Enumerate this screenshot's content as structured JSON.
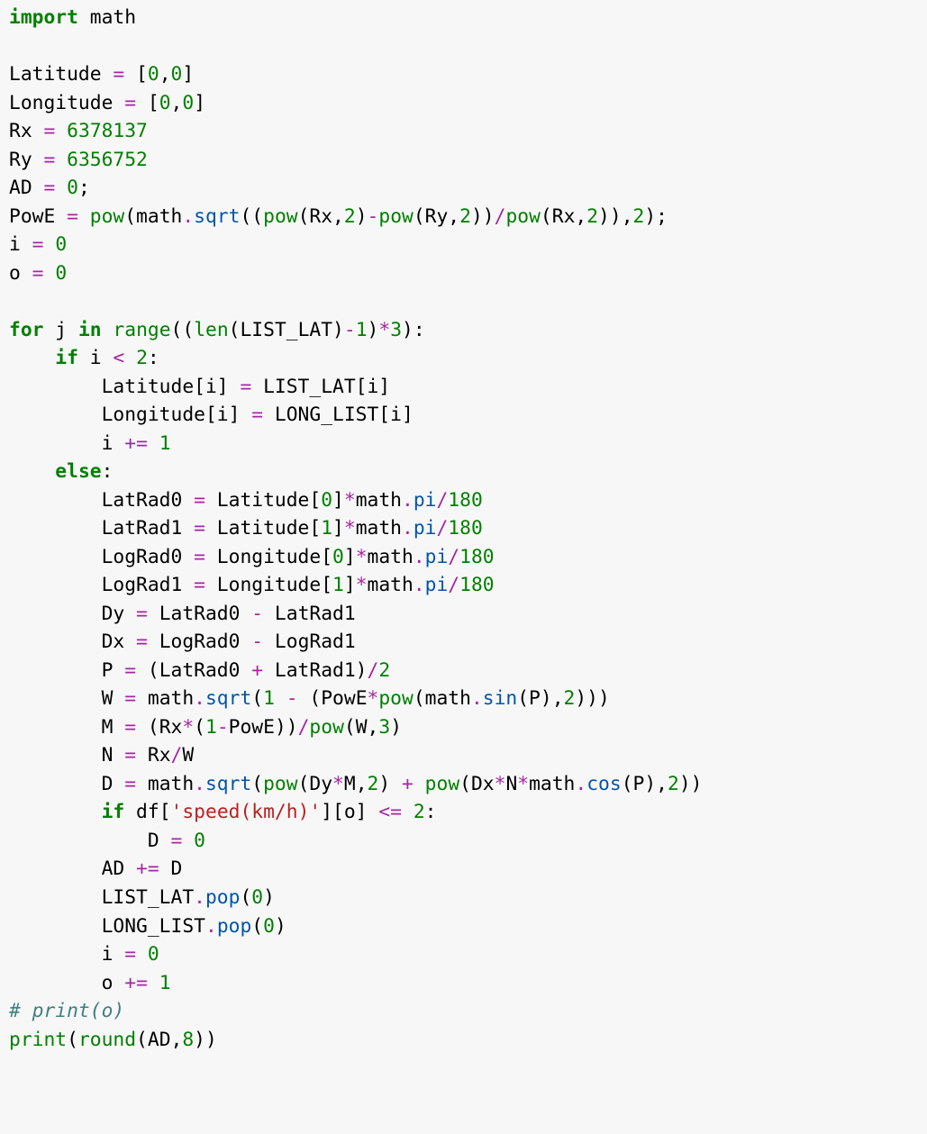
{
  "code": {
    "language": "python",
    "lines": [
      [
        [
          "kw",
          "import"
        ],
        [
          "txt",
          " math"
        ]
      ],
      [],
      [
        [
          "txt",
          "Latitude "
        ],
        [
          "op",
          "="
        ],
        [
          "txt",
          " ["
        ],
        [
          "num",
          "0"
        ],
        [
          "txt",
          ","
        ],
        [
          "num",
          "0"
        ],
        [
          "txt",
          "]"
        ]
      ],
      [
        [
          "txt",
          "Longitude "
        ],
        [
          "op",
          "="
        ],
        [
          "txt",
          " ["
        ],
        [
          "num",
          "0"
        ],
        [
          "txt",
          ","
        ],
        [
          "num",
          "0"
        ],
        [
          "txt",
          "]"
        ]
      ],
      [
        [
          "txt",
          "Rx "
        ],
        [
          "op",
          "="
        ],
        [
          "txt",
          " "
        ],
        [
          "num",
          "6378137"
        ]
      ],
      [
        [
          "txt",
          "Ry "
        ],
        [
          "op",
          "="
        ],
        [
          "txt",
          " "
        ],
        [
          "num",
          "6356752"
        ]
      ],
      [
        [
          "txt",
          "AD "
        ],
        [
          "op",
          "="
        ],
        [
          "txt",
          " "
        ],
        [
          "num",
          "0"
        ],
        [
          "txt",
          ";"
        ]
      ],
      [
        [
          "txt",
          "PowE "
        ],
        [
          "op",
          "="
        ],
        [
          "txt",
          " "
        ],
        [
          "fn",
          "pow"
        ],
        [
          "txt",
          "(math"
        ],
        [
          "op",
          "."
        ],
        [
          "attr",
          "sqrt"
        ],
        [
          "txt",
          "(("
        ],
        [
          "fn",
          "pow"
        ],
        [
          "txt",
          "(Rx,"
        ],
        [
          "num",
          "2"
        ],
        [
          "txt",
          ")"
        ],
        [
          "op",
          "-"
        ],
        [
          "fn",
          "pow"
        ],
        [
          "txt",
          "(Ry,"
        ],
        [
          "num",
          "2"
        ],
        [
          "txt",
          "))"
        ],
        [
          "op",
          "/"
        ],
        [
          "fn",
          "pow"
        ],
        [
          "txt",
          "(Rx,"
        ],
        [
          "num",
          "2"
        ],
        [
          "txt",
          ")),"
        ],
        [
          "num",
          "2"
        ],
        [
          "txt",
          ");"
        ]
      ],
      [
        [
          "txt",
          "i "
        ],
        [
          "op",
          "="
        ],
        [
          "txt",
          " "
        ],
        [
          "num",
          "0"
        ]
      ],
      [
        [
          "txt",
          "o "
        ],
        [
          "op",
          "="
        ],
        [
          "txt",
          " "
        ],
        [
          "num",
          "0"
        ]
      ],
      [],
      [
        [
          "kw",
          "for"
        ],
        [
          "txt",
          " j "
        ],
        [
          "kw",
          "in"
        ],
        [
          "txt",
          " "
        ],
        [
          "fn",
          "range"
        ],
        [
          "txt",
          "(("
        ],
        [
          "fn",
          "len"
        ],
        [
          "txt",
          "(LIST_LAT)"
        ],
        [
          "op",
          "-"
        ],
        [
          "num",
          "1"
        ],
        [
          "txt",
          ")"
        ],
        [
          "op",
          "*"
        ],
        [
          "num",
          "3"
        ],
        [
          "txt",
          "):"
        ]
      ],
      [
        [
          "txt",
          "    "
        ],
        [
          "kw",
          "if"
        ],
        [
          "txt",
          " i "
        ],
        [
          "op",
          "<"
        ],
        [
          "txt",
          " "
        ],
        [
          "num",
          "2"
        ],
        [
          "txt",
          ":"
        ]
      ],
      [
        [
          "txt",
          "        Latitude[i] "
        ],
        [
          "op",
          "="
        ],
        [
          "txt",
          " LIST_LAT[i]"
        ]
      ],
      [
        [
          "txt",
          "        Longitude[i] "
        ],
        [
          "op",
          "="
        ],
        [
          "txt",
          " LONG_LIST[i]"
        ]
      ],
      [
        [
          "txt",
          "        i "
        ],
        [
          "op",
          "+="
        ],
        [
          "txt",
          " "
        ],
        [
          "num",
          "1"
        ]
      ],
      [
        [
          "txt",
          "    "
        ],
        [
          "kw",
          "else"
        ],
        [
          "txt",
          ":"
        ]
      ],
      [
        [
          "txt",
          "        LatRad0 "
        ],
        [
          "op",
          "="
        ],
        [
          "txt",
          " Latitude["
        ],
        [
          "num",
          "0"
        ],
        [
          "txt",
          "]"
        ],
        [
          "op",
          "*"
        ],
        [
          "txt",
          "math"
        ],
        [
          "op",
          "."
        ],
        [
          "attr",
          "pi"
        ],
        [
          "op",
          "/"
        ],
        [
          "num",
          "180"
        ]
      ],
      [
        [
          "txt",
          "        LatRad1 "
        ],
        [
          "op",
          "="
        ],
        [
          "txt",
          " Latitude["
        ],
        [
          "num",
          "1"
        ],
        [
          "txt",
          "]"
        ],
        [
          "op",
          "*"
        ],
        [
          "txt",
          "math"
        ],
        [
          "op",
          "."
        ],
        [
          "attr",
          "pi"
        ],
        [
          "op",
          "/"
        ],
        [
          "num",
          "180"
        ]
      ],
      [
        [
          "txt",
          "        LogRad0 "
        ],
        [
          "op",
          "="
        ],
        [
          "txt",
          " Longitude["
        ],
        [
          "num",
          "0"
        ],
        [
          "txt",
          "]"
        ],
        [
          "op",
          "*"
        ],
        [
          "txt",
          "math"
        ],
        [
          "op",
          "."
        ],
        [
          "attr",
          "pi"
        ],
        [
          "op",
          "/"
        ],
        [
          "num",
          "180"
        ]
      ],
      [
        [
          "txt",
          "        LogRad1 "
        ],
        [
          "op",
          "="
        ],
        [
          "txt",
          " Longitude["
        ],
        [
          "num",
          "1"
        ],
        [
          "txt",
          "]"
        ],
        [
          "op",
          "*"
        ],
        [
          "txt",
          "math"
        ],
        [
          "op",
          "."
        ],
        [
          "attr",
          "pi"
        ],
        [
          "op",
          "/"
        ],
        [
          "num",
          "180"
        ]
      ],
      [
        [
          "txt",
          "        Dy "
        ],
        [
          "op",
          "="
        ],
        [
          "txt",
          " LatRad0 "
        ],
        [
          "op",
          "-"
        ],
        [
          "txt",
          " LatRad1"
        ]
      ],
      [
        [
          "txt",
          "        Dx "
        ],
        [
          "op",
          "="
        ],
        [
          "txt",
          " LogRad0 "
        ],
        [
          "op",
          "-"
        ],
        [
          "txt",
          " LogRad1"
        ]
      ],
      [
        [
          "txt",
          "        P "
        ],
        [
          "op",
          "="
        ],
        [
          "txt",
          " (LatRad0 "
        ],
        [
          "op",
          "+"
        ],
        [
          "txt",
          " LatRad1)"
        ],
        [
          "op",
          "/"
        ],
        [
          "num",
          "2"
        ]
      ],
      [
        [
          "txt",
          "        W "
        ],
        [
          "op",
          "="
        ],
        [
          "txt",
          " math"
        ],
        [
          "op",
          "."
        ],
        [
          "attr",
          "sqrt"
        ],
        [
          "txt",
          "("
        ],
        [
          "num",
          "1"
        ],
        [
          "txt",
          " "
        ],
        [
          "op",
          "-"
        ],
        [
          "txt",
          " (PowE"
        ],
        [
          "op",
          "*"
        ],
        [
          "fn",
          "pow"
        ],
        [
          "txt",
          "(math"
        ],
        [
          "op",
          "."
        ],
        [
          "attr",
          "sin"
        ],
        [
          "txt",
          "(P),"
        ],
        [
          "num",
          "2"
        ],
        [
          "txt",
          ")))"
        ]
      ],
      [
        [
          "txt",
          "        M "
        ],
        [
          "op",
          "="
        ],
        [
          "txt",
          " (Rx"
        ],
        [
          "op",
          "*"
        ],
        [
          "txt",
          "("
        ],
        [
          "num",
          "1"
        ],
        [
          "op",
          "-"
        ],
        [
          "txt",
          "PowE))"
        ],
        [
          "op",
          "/"
        ],
        [
          "fn",
          "pow"
        ],
        [
          "txt",
          "(W,"
        ],
        [
          "num",
          "3"
        ],
        [
          "txt",
          ")"
        ]
      ],
      [
        [
          "txt",
          "        N "
        ],
        [
          "op",
          "="
        ],
        [
          "txt",
          " Rx"
        ],
        [
          "op",
          "/"
        ],
        [
          "txt",
          "W"
        ]
      ],
      [
        [
          "txt",
          "        D "
        ],
        [
          "op",
          "="
        ],
        [
          "txt",
          " math"
        ],
        [
          "op",
          "."
        ],
        [
          "attr",
          "sqrt"
        ],
        [
          "txt",
          "("
        ],
        [
          "fn",
          "pow"
        ],
        [
          "txt",
          "(Dy"
        ],
        [
          "op",
          "*"
        ],
        [
          "txt",
          "M,"
        ],
        [
          "num",
          "2"
        ],
        [
          "txt",
          ") "
        ],
        [
          "op",
          "+"
        ],
        [
          "txt",
          " "
        ],
        [
          "fn",
          "pow"
        ],
        [
          "txt",
          "(Dx"
        ],
        [
          "op",
          "*"
        ],
        [
          "txt",
          "N"
        ],
        [
          "op",
          "*"
        ],
        [
          "txt",
          "math"
        ],
        [
          "op",
          "."
        ],
        [
          "attr",
          "cos"
        ],
        [
          "txt",
          "(P),"
        ],
        [
          "num",
          "2"
        ],
        [
          "txt",
          "))"
        ]
      ],
      [
        [
          "txt",
          "        "
        ],
        [
          "kw",
          "if"
        ],
        [
          "txt",
          " df["
        ],
        [
          "str",
          "'speed(km/h)'"
        ],
        [
          "txt",
          "][o] "
        ],
        [
          "op",
          "<="
        ],
        [
          "txt",
          " "
        ],
        [
          "num",
          "2"
        ],
        [
          "txt",
          ":"
        ]
      ],
      [
        [
          "txt",
          "            D "
        ],
        [
          "op",
          "="
        ],
        [
          "txt",
          " "
        ],
        [
          "num",
          "0"
        ]
      ],
      [
        [
          "txt",
          "        AD "
        ],
        [
          "op",
          "+="
        ],
        [
          "txt",
          " D"
        ]
      ],
      [
        [
          "txt",
          "        LIST_LAT"
        ],
        [
          "op",
          "."
        ],
        [
          "attr",
          "pop"
        ],
        [
          "txt",
          "("
        ],
        [
          "num",
          "0"
        ],
        [
          "txt",
          ")"
        ]
      ],
      [
        [
          "txt",
          "        LONG_LIST"
        ],
        [
          "op",
          "."
        ],
        [
          "attr",
          "pop"
        ],
        [
          "txt",
          "("
        ],
        [
          "num",
          "0"
        ],
        [
          "txt",
          ")"
        ]
      ],
      [
        [
          "txt",
          "        i "
        ],
        [
          "op",
          "="
        ],
        [
          "txt",
          " "
        ],
        [
          "num",
          "0"
        ]
      ],
      [
        [
          "txt",
          "        o "
        ],
        [
          "op",
          "+="
        ],
        [
          "txt",
          " "
        ],
        [
          "num",
          "1"
        ]
      ],
      [
        [
          "cmt",
          "# print(o)"
        ]
      ],
      [
        [
          "fn",
          "print"
        ],
        [
          "txt",
          "("
        ],
        [
          "fn",
          "round"
        ],
        [
          "txt",
          "(AD,"
        ],
        [
          "num",
          "8"
        ],
        [
          "txt",
          "))"
        ]
      ]
    ]
  }
}
